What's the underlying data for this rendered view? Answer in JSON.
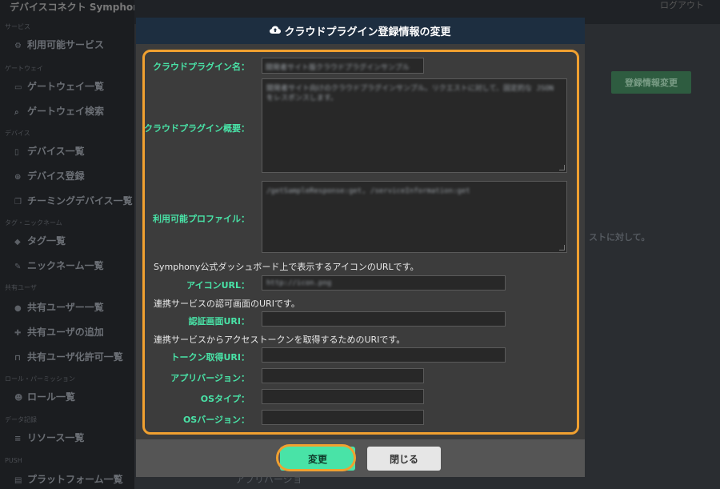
{
  "app": {
    "brand": "デバイスコネクト Symphony",
    "top_right": "ログアウト"
  },
  "sidebar": {
    "sections": [
      {
        "label": "サービス",
        "items": [
          {
            "label": "利用可能サービス",
            "icon": "services-icon"
          }
        ]
      },
      {
        "label": "ゲートウェイ",
        "items": [
          {
            "label": "ゲートウェイ一覧",
            "icon": "gateway-icon"
          },
          {
            "label": "ゲートウェイ検索",
            "icon": "search-icon"
          }
        ]
      },
      {
        "label": "デバイス",
        "items": [
          {
            "label": "デバイス一覧",
            "icon": "mobile-icon"
          },
          {
            "label": "デバイス登録",
            "icon": "plus-circle-icon"
          },
          {
            "label": "チーミングデバイス一覧",
            "icon": "clone-icon"
          }
        ]
      },
      {
        "label": "タグ・ニックネーム",
        "items": [
          {
            "label": "タグ一覧",
            "icon": "tag-icon"
          },
          {
            "label": "ニックネーム一覧",
            "icon": "pencil-icon"
          }
        ]
      },
      {
        "label": "共有ユーザ",
        "items": [
          {
            "label": "共有ユーザー一覧",
            "icon": "user-icon"
          },
          {
            "label": "共有ユーザの追加",
            "icon": "user-plus-icon"
          },
          {
            "label": "共有ユーザ化許可一覧",
            "icon": "unlock-icon"
          }
        ]
      },
      {
        "label": "ロール・パーミッション",
        "items": [
          {
            "label": "ロール一覧",
            "icon": "users-icon"
          }
        ]
      },
      {
        "label": "データ記録",
        "items": [
          {
            "label": "リソース一覧",
            "icon": "database-icon"
          }
        ]
      },
      {
        "label": "PUSH",
        "items": [
          {
            "label": "プラットフォーム一覧",
            "icon": "platform-icon"
          }
        ]
      }
    ]
  },
  "background": {
    "edit_button": "登録情報変更",
    "partial_text": "ストに対して。",
    "bottom_text": "アプリバージョ"
  },
  "modal": {
    "title": "クラウドプラグイン登録情報の変更",
    "title_icon": "cloud-upload-icon",
    "fields": {
      "name": {
        "label": "クラウドプラグイン名：",
        "value": "開発者サイト版クラウドプラグインサンプル"
      },
      "summary": {
        "label": "クラウドプラグイン概要：",
        "value": "開発者サイト向けのクラウドプラグインサンプル。リクエストに対して、固定的な JSON をレスポンスします。"
      },
      "profile": {
        "label": "利用可能プロファイル：",
        "value": "/getSampleResponse:get, /serviceInformation:get"
      },
      "icon_url": {
        "note": "Symphony公式ダッシュボード上で表示するアイコンのURLです。",
        "label": "アイコンURL：",
        "value": "http://icon.png"
      },
      "auth_uri": {
        "note": "連携サービスの認可画面のURIです。",
        "label": "認証画面URI：",
        "value": ""
      },
      "token_uri": {
        "note": "連携サービスからアクセストークンを取得するためのURIです。",
        "label": "トークン取得URI：",
        "value": ""
      },
      "app_version": {
        "label": "アプリバージョン：",
        "value": ""
      },
      "os_type": {
        "label": "OSタイプ：",
        "value": ""
      },
      "os_version": {
        "label": "OSバージョン：",
        "value": ""
      }
    },
    "buttons": {
      "submit": "変更",
      "close": "閉じる"
    }
  },
  "colors": {
    "accent": "#49e3a7",
    "highlight": "#f0a030",
    "header": "#1d2e40"
  }
}
